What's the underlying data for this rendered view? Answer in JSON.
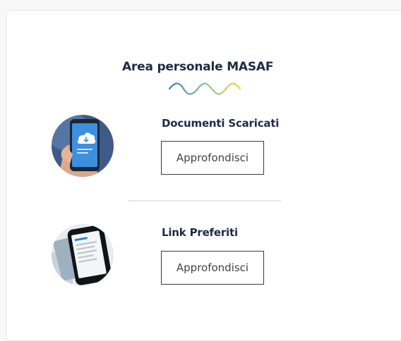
{
  "card": {
    "title": "Area personale MASAF"
  },
  "items": [
    {
      "title": "Documenti Scaricati",
      "button_label": "Approfondisci",
      "image_icon": "phone-cloud-icon"
    },
    {
      "title": "Link Preferiti",
      "button_label": "Approfondisci",
      "image_icon": "phone-list-icon"
    }
  ],
  "colors": {
    "title_text": "#1f2a44",
    "wave_start": "#4a7bc0",
    "wave_end": "#e9d83a",
    "button_border": "#3b3b3b",
    "divider": "#e8e8e8"
  }
}
